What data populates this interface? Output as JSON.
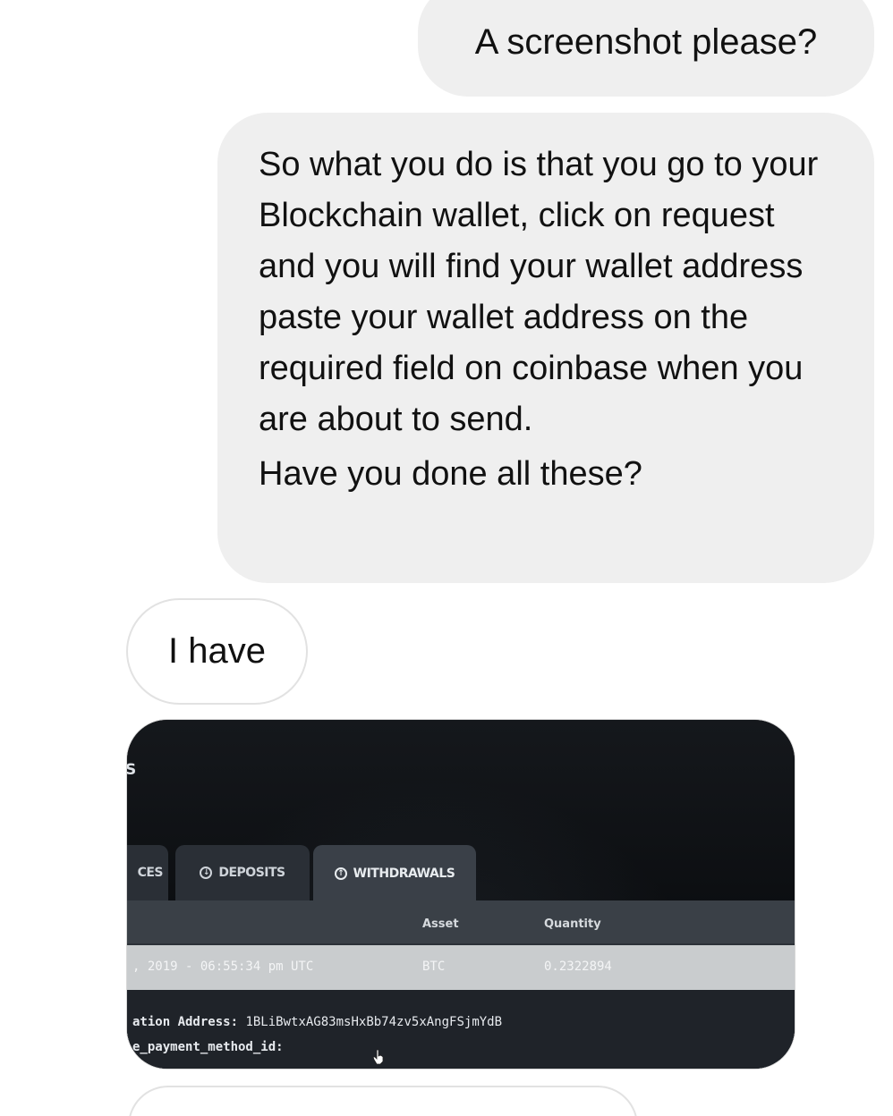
{
  "messages": [
    {
      "from": "me",
      "text": "A screenshot please?"
    },
    {
      "from": "me",
      "paragraphs": [
        "So what you do is that you go to your Blockchain wallet, click on request and you will find your wallet address paste your wallet address on the required field on coinbase when you are about to send.",
        "Have you done all these?"
      ]
    },
    {
      "from": "them",
      "text": "I have"
    }
  ],
  "attachment": {
    "corner_label": "S",
    "tabs": {
      "balances": "CES",
      "deposits": "DEPOSITS",
      "withdrawals": "WITHDRAWALS"
    },
    "columns": {
      "asset": "Asset",
      "quantity": "Quantity"
    },
    "row": {
      "date": ", 2019 - 06:55:34 pm UTC",
      "asset": "BTC",
      "quantity": "0.2322894"
    },
    "detail": {
      "address_label": "ation Address:",
      "address_value": "1BLiBwtxAG83msHxBb74zv5xAngFSjmYdB",
      "payment_label": "e_payment_method_id:"
    }
  }
}
